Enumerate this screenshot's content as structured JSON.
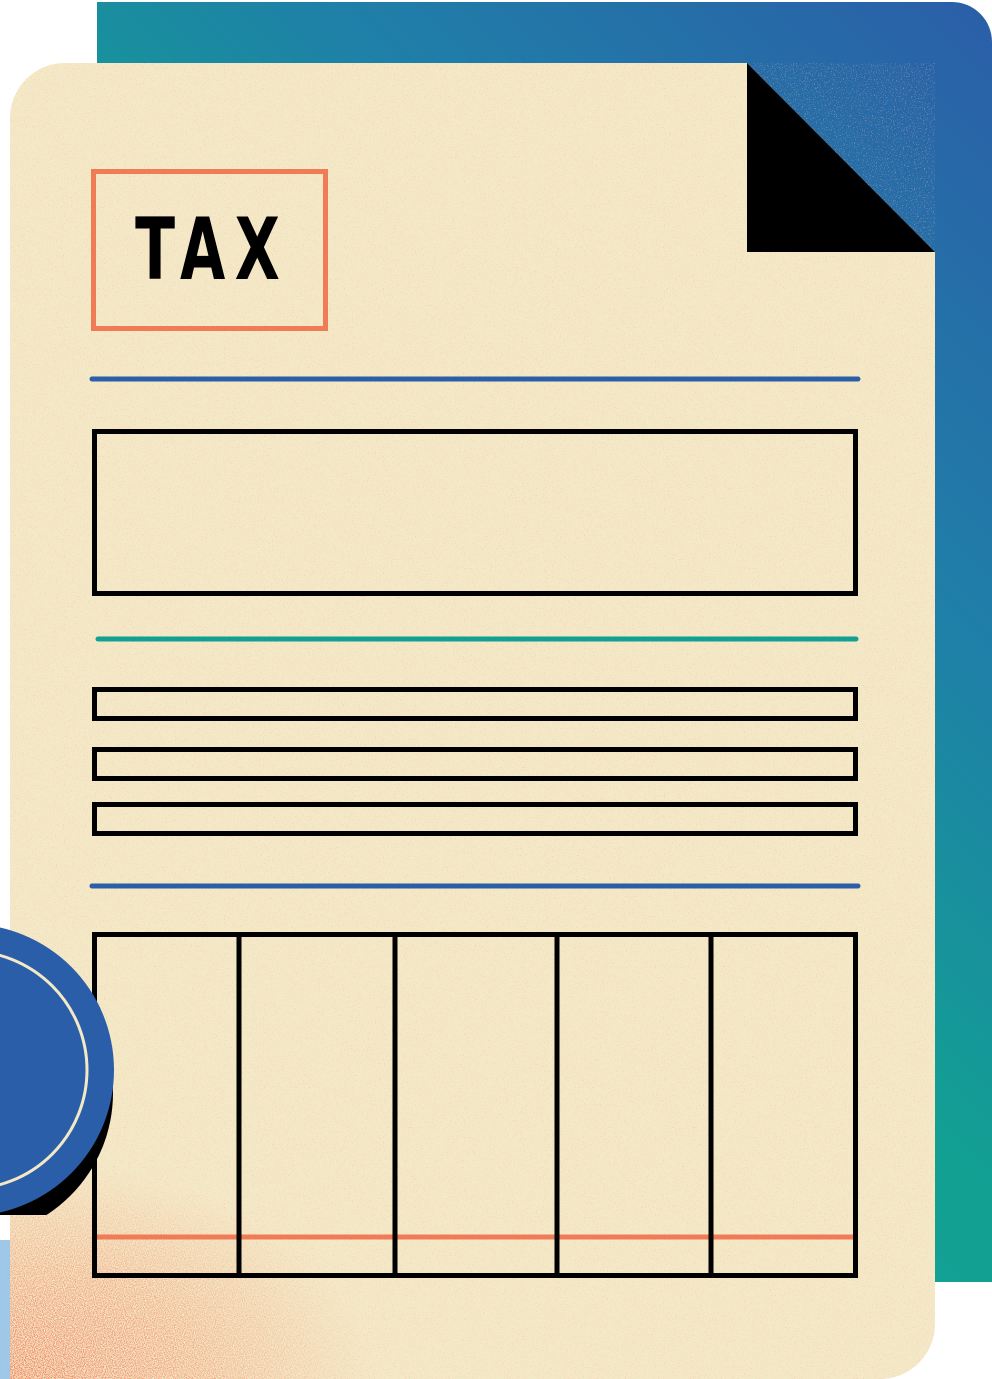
{
  "document": {
    "badge_text": "TAX",
    "badge_border_color": "#f07b57",
    "paper_color": "#f4e9c7",
    "accent_blue": "#2b5ea8",
    "accent_teal": "#12a093",
    "accent_orange": "#f07b57",
    "form_line_color": "#000000",
    "table_columns": 5,
    "single_line_fields": 3
  },
  "seal": {
    "color": "#2b5ea8",
    "ring_color": "#f4e9c7"
  }
}
